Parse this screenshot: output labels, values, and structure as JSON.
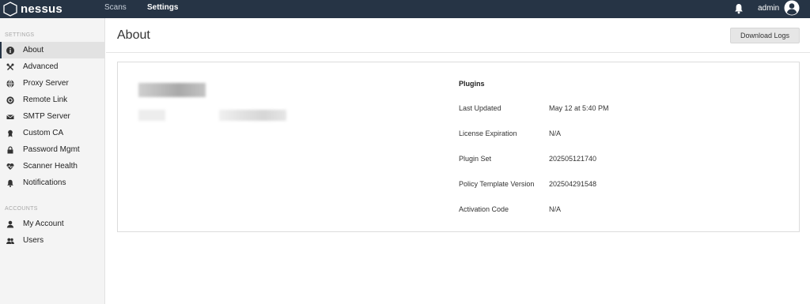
{
  "topbar": {
    "logo_text": "nessus",
    "nav": [
      {
        "label": "Scans",
        "active": false
      },
      {
        "label": "Settings",
        "active": true
      }
    ],
    "user": {
      "name": "admin"
    },
    "icons": {
      "bell": "bell-icon",
      "avatar": "user-avatar-icon"
    }
  },
  "sidebar": {
    "settings_title": "SETTINGS",
    "settings_items": [
      {
        "label": "About",
        "icon": "info-icon",
        "active": true
      },
      {
        "label": "Advanced",
        "icon": "tools-icon",
        "active": false
      },
      {
        "label": "Proxy Server",
        "icon": "globe-icon",
        "active": false
      },
      {
        "label": "Remote Link",
        "icon": "link-icon",
        "active": false
      },
      {
        "label": "SMTP Server",
        "icon": "envelope-icon",
        "active": false
      },
      {
        "label": "Custom CA",
        "icon": "certificate-icon",
        "active": false
      },
      {
        "label": "Password Mgmt",
        "icon": "lock-icon",
        "active": false
      },
      {
        "label": "Scanner Health",
        "icon": "heartbeat-icon",
        "active": false
      },
      {
        "label": "Notifications",
        "icon": "bell-icon",
        "active": false
      }
    ],
    "accounts_title": "ACCOUNTS",
    "accounts_items": [
      {
        "label": "My Account",
        "icon": "user-icon",
        "active": false
      },
      {
        "label": "Users",
        "icon": "users-icon",
        "active": false
      }
    ]
  },
  "main": {
    "title": "About",
    "download_button": "Download Logs",
    "plugins": {
      "heading": "Plugins",
      "rows": [
        {
          "label": "Last Updated",
          "value": "May 12 at 5:40 PM"
        },
        {
          "label": "License Expiration",
          "value": "N/A"
        },
        {
          "label": "Plugin Set",
          "value": "202505121740"
        },
        {
          "label": "Policy Template Version",
          "value": "202504291548"
        },
        {
          "label": "Activation Code",
          "value": "N/A"
        }
      ]
    }
  },
  "colors": {
    "topbar_bg": "#263445",
    "sidebar_bg": "#f4f4f4",
    "sidebar_active_bg": "#e2e2e2"
  }
}
